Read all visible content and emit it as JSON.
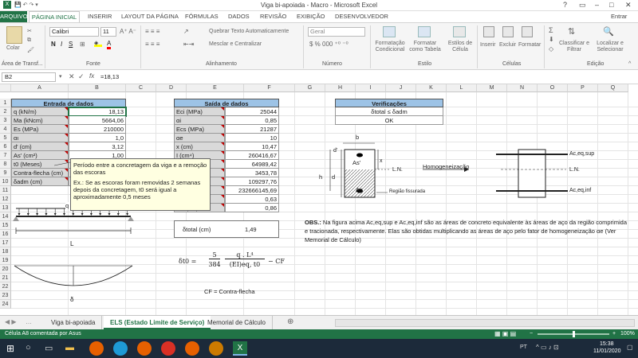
{
  "window": {
    "title": "Viga bi-apoiada - Macro - Microsoft Excel",
    "user": "Entrar"
  },
  "tabs": [
    "ARQUIVO",
    "PÁGINA INICIAL",
    "INSERIR",
    "LAYOUT DA PÁGINA",
    "FÓRMULAS",
    "DADOS",
    "REVISÃO",
    "EXIBIÇÃO",
    "DESENVOLVEDOR"
  ],
  "ribbon": {
    "paste": "Colar",
    "font_name": "Calibri",
    "font_size": "11",
    "wrap": "Quebrar Texto Automaticamente",
    "merge": "Mesclar e Centralizar",
    "numfmt": "Geral",
    "cond": "Formatação Condicional",
    "astable": "Formatar como Tabela",
    "cellstyles": "Estilos de Célula",
    "insert": "Inserir",
    "delete": "Excluir",
    "format": "Formatar",
    "sort": "Classificar e Filtrar",
    "find": "Localizar e Selecionar",
    "groups": [
      "Área de Transf...",
      "Fonte",
      "Alinhamento",
      "Número",
      "Estilo",
      "Células",
      "Edição"
    ]
  },
  "formula": {
    "name": "B2",
    "value": "=18,13"
  },
  "columns": [
    "A",
    "B",
    "C",
    "D",
    "E",
    "F",
    "G",
    "H",
    "I",
    "J",
    "K",
    "L",
    "M",
    "N",
    "O",
    "P",
    "Q"
  ],
  "rows": [
    "1",
    "2",
    "3",
    "4",
    "5",
    "6",
    "7",
    "8",
    "9",
    "10",
    "11",
    "12",
    "13",
    "14",
    "15",
    "16",
    "17",
    "18",
    "19",
    "20",
    "21",
    "22",
    "23",
    "24"
  ],
  "input": {
    "title": "Entrada de dados",
    "items": [
      {
        "label": "q (kN/m)",
        "value": "18,13"
      },
      {
        "label": "Ma (kNcm)",
        "value": "5664,06"
      },
      {
        "label": "Es (MPa)",
        "value": "210000"
      },
      {
        "label": "αι",
        "value": "1,0"
      },
      {
        "label": "d' (cm)",
        "value": "3,12"
      },
      {
        "label": "As' (cm²)",
        "value": "1,00"
      },
      {
        "label": "t0 (Meses)",
        "value": ""
      },
      {
        "label": "Contra-flecha (cm)",
        "value": ""
      },
      {
        "label": "δadm (cm)",
        "value": ""
      }
    ]
  },
  "output": {
    "title": "Saída de dados",
    "items": [
      {
        "label": "Eci (MPa)",
        "value": "25044"
      },
      {
        "label": "αi",
        "value": "0,85"
      },
      {
        "label": "Ecs (MPa)",
        "value": "21287"
      },
      {
        "label": "αe",
        "value": "10"
      },
      {
        "label": "x (cm)",
        "value": "10,47"
      },
      {
        "label": "I (cm⁴)",
        "value": "260416,67"
      },
      {
        "label": "",
        "value": "64989,42"
      },
      {
        "label": "",
        "value": "3453,78"
      },
      {
        "label": "",
        "value": "109297,76"
      },
      {
        "label": "(kNcm²)",
        "value": "232666145,69"
      },
      {
        "label": "δt (cm) =",
        "value": "0,63"
      },
      {
        "label": "δt,f (cm) =",
        "value": "0,86"
      }
    ],
    "delta_label": "δtotal (cm)",
    "delta_value": "1,49"
  },
  "verify": {
    "title": "Verificações",
    "cond": "δtotal ≤ δadm",
    "result": "OK"
  },
  "comment": {
    "line1": "Período entre a concretagem da viga e a remoção das escoras",
    "line2": "Ex.: Se as escoras foram removidas 2 semanas depois da concretagem, t0 será igual a aproximadamente 0,5 meses"
  },
  "beam": {
    "load": "q (kN/m)",
    "span": "L",
    "deflection": "δ"
  },
  "section": {
    "b": "b",
    "d1": "d'",
    "h": "h",
    "d": "d",
    "x": "x",
    "as1": "As'",
    "as": "As",
    "ln": "L.N.",
    "crack": "Região fissurada",
    "homog": "Homogeneização",
    "sup": "Ac,eq,sup",
    "inf": "Ac,eq,inf"
  },
  "formula_text": {
    "lhs": "δt0 =",
    "num1": "5",
    "den1": "384",
    "frac2_num": "q . L⁴",
    "frac2_den": "(EI)eq, t0",
    "tail": "− CF",
    "cf": "CF = Contra-flecha"
  },
  "obs": {
    "bold": "OBS.:",
    "text": " Na figura acima Ac,eq,sup e Ac,eq,inf são as áreas de concreto equivalente às áreas de aço da região comprimida e tracionada, respectivamente. Elas são obtidas multiplicando as áreas de aço pelo fator de homogeneização αe (Ver Memorial de Cálculo)"
  },
  "sheets": [
    "Viga bi-apoiada",
    "ELS (Estado Limite de Serviço)",
    "Memorial de Cálculo"
  ],
  "status": {
    "left": "Célula A8 comentada por Asus",
    "zoom": "100%"
  },
  "taskbar": {
    "lang": "PT",
    "time": "15:38",
    "date": "11/01/2020"
  },
  "colors": {
    "excel_green": "#217346",
    "header_blue": "#9dc3e6",
    "label_gray": "#d9d9d9"
  }
}
